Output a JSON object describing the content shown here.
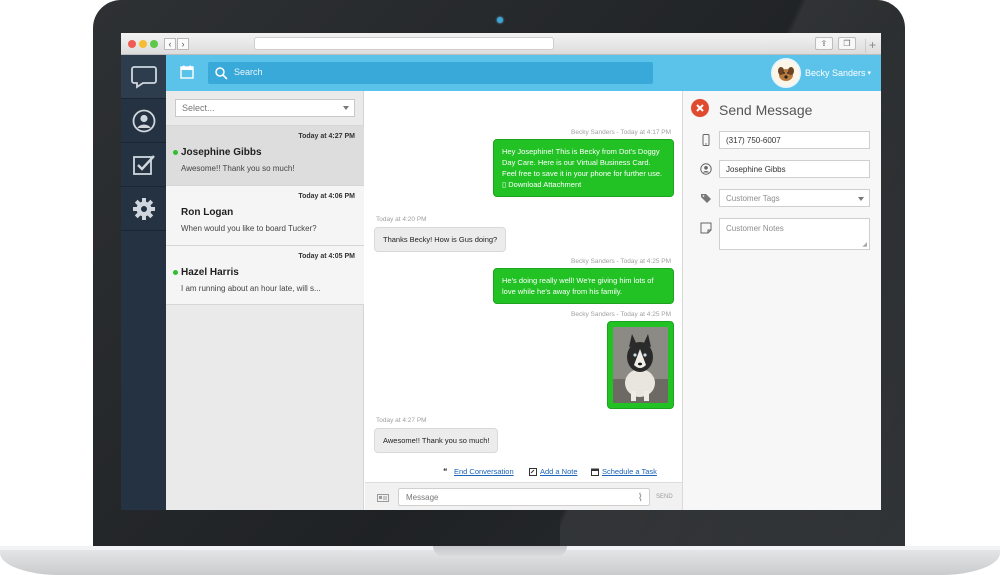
{
  "user": {
    "name": "Becky Sanders"
  },
  "search": {
    "placeholder": "Search"
  },
  "filter": {
    "placeholder": "Select..."
  },
  "conversations": [
    {
      "name": "Josephine Gibbs",
      "time": "Today at 4:27 PM",
      "preview": "Awesome!! Thank you so much!",
      "unread": true
    },
    {
      "name": "Ron Logan",
      "time": "Today at 4:06 PM",
      "preview": "When would you like to board Tucker?",
      "unread": false
    },
    {
      "name": "Hazel Harris",
      "time": "Today at 4:05 PM",
      "preview": "I am running about an hour late, will s...",
      "unread": true
    }
  ],
  "messages": [
    {
      "meta": "Becky Sanders - Today at 4:17 PM",
      "text": "Hey Josephine! This is Becky from Dot's Doggy Day Care. Here is our Virtual Business Card. Feel free to save it in your phone for further use.",
      "attachment": "Download Attachment"
    },
    {
      "meta": "Today at 4:20 PM",
      "text": "Thanks Becky! How is Gus doing?"
    },
    {
      "meta": "Becky Sanders - Today at 4:25 PM",
      "text": "He's doing really well! We're giving him lots of love while he's away from his family."
    },
    {
      "meta": "Becky Sanders - Today at 4:25 PM",
      "image": "photo-of-husky-dog"
    },
    {
      "meta": "Today at 4:27 PM",
      "text": "Awesome!! Thank you so much!"
    }
  ],
  "actions": {
    "end_conversation": "End Conversation",
    "add_note": "Add a Note",
    "schedule_task": "Schedule a Task"
  },
  "composer": {
    "placeholder": "Message",
    "send_label": "SEND"
  },
  "send_panel": {
    "title": "Send Message",
    "phone": "(317) 750-6007",
    "customer_name": "Josephine Gibbs",
    "tags_placeholder": "Customer Tags",
    "notes_placeholder": "Customer Notes"
  },
  "colors": {
    "accent": "#5bc3ea",
    "outgoing": "#22c225",
    "rail": "#253241",
    "close": "#e04b2f"
  }
}
